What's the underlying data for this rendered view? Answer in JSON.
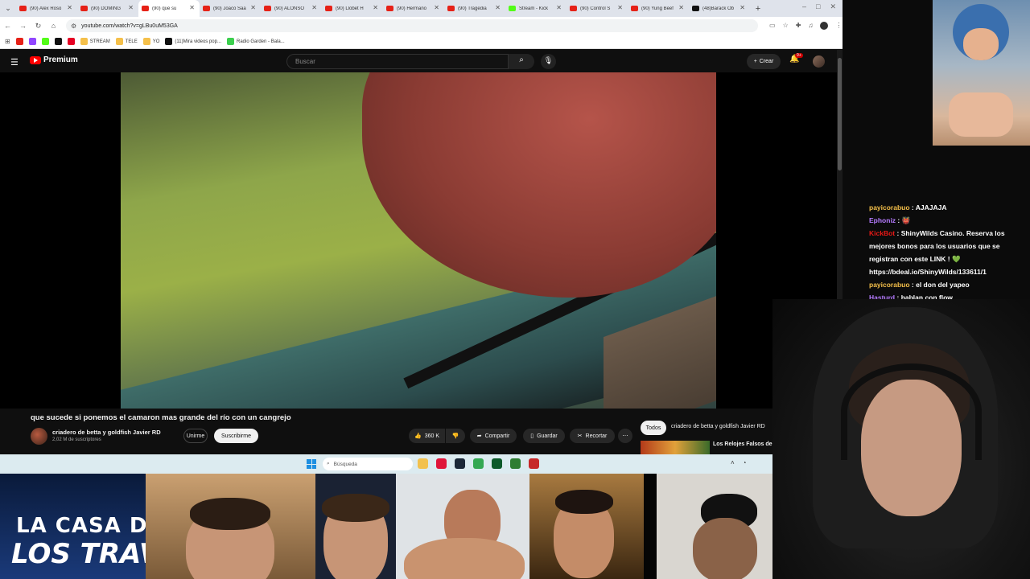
{
  "browser": {
    "tabs": [
      {
        "title": "(90) Alex Roso",
        "icon": "youtube-icon"
      },
      {
        "title": "(90) DOMING",
        "icon": "youtube-icon"
      },
      {
        "title": "(90) que su",
        "icon": "youtube-icon",
        "active": true
      },
      {
        "title": "(90) Joaco Saa",
        "icon": "youtube-icon"
      },
      {
        "title": "(90) ALONSO",
        "icon": "youtube-icon"
      },
      {
        "title": "(90) Llobet H",
        "icon": "youtube-icon"
      },
      {
        "title": "(90) Hermano",
        "icon": "youtube-icon"
      },
      {
        "title": "(90) Tragedia",
        "icon": "youtube-icon"
      },
      {
        "title": "Stream - Kick",
        "icon": "kick-icon"
      },
      {
        "title": "(90) Control S",
        "icon": "youtube-icon"
      },
      {
        "title": "(90) Yung Beef",
        "icon": "youtube-icon"
      },
      {
        "title": "(48)Barack Ob",
        "icon": "tiktok-icon"
      }
    ],
    "url": "youtube.com/watch?v=gLBu0uM53GA",
    "bookmarks": [
      {
        "label": "",
        "color": "#e62117"
      },
      {
        "label": "",
        "color": "#9146ff"
      },
      {
        "label": "",
        "color": "#53fc18"
      },
      {
        "label": "",
        "color": "#111111"
      },
      {
        "label": "",
        "color": "#e60023"
      },
      {
        "label": "STREAM",
        "color": "#f5c04a"
      },
      {
        "label": "TELE",
        "color": "#f5c04a"
      },
      {
        "label": "YO",
        "color": "#f5c04a"
      },
      {
        "label": "(11)Mira videos pop...",
        "color": "#111111"
      },
      {
        "label": "Radio Garden - Bala...",
        "color": "#3ccf4e"
      }
    ]
  },
  "youtube": {
    "logo_text": "Premium",
    "search_placeholder": "Buscar",
    "create_label": "Crear",
    "notif_badge": "9+",
    "video_title": "que sucede si ponemos el camaron mas grande del río con un cangrejo",
    "channel_name": "criadero de betta y goldfish Javier RD",
    "channel_subs": "2,02 M de suscriptores",
    "join_label": "Unirme",
    "subscribe_label": "Suscribirme",
    "likes": "360 K",
    "share_label": "Compartir",
    "save_label": "Guardar",
    "clip_label": "Recortar",
    "chips": {
      "all": "Todos",
      "channel": "criadero de betta y goldfish Javier RD"
    },
    "rec_title": "Los Relojes Falsos de $"
  },
  "taskbar": {
    "search_placeholder": "Búsqueda",
    "apps": [
      {
        "icon": "file-explorer-icon",
        "color": "#f2c14e"
      },
      {
        "icon": "opera-icon",
        "color": "#e0163a"
      },
      {
        "icon": "steam-icon",
        "color": "#1b2838"
      },
      {
        "icon": "chrome-icon",
        "color": "#34a853"
      },
      {
        "icon": "terminal-icon",
        "color": "#0c5a2a"
      },
      {
        "icon": "app-icon",
        "color": "#2e7d32"
      },
      {
        "icon": "app-red-icon",
        "color": "#c62828"
      }
    ]
  },
  "chat": {
    "messages": [
      {
        "user": "payicorabuo",
        "text": "AJAJAJA",
        "color": "#f5c04a"
      },
      {
        "user": "Ephoniz",
        "text": "👹",
        "color": "#b57bff"
      },
      {
        "user": "KickBot",
        "text": "ShinyWilds Casino. Reserva los mejores bonos para los usuarios que se registran con este LINK ! 💚 https://bdeal.io/ShinyWilds/133611/1",
        "color": "#e91916"
      },
      {
        "user": "payicorabuo",
        "text": "el don del yapeo",
        "color": "#f5c04a"
      },
      {
        "user": "Hasturd",
        "text": "hablan con flow",
        "color": "#b57bff"
      }
    ]
  },
  "overlay": {
    "logo_line1": "LA CASA D",
    "logo_line2": "LOS TRAVELO"
  }
}
